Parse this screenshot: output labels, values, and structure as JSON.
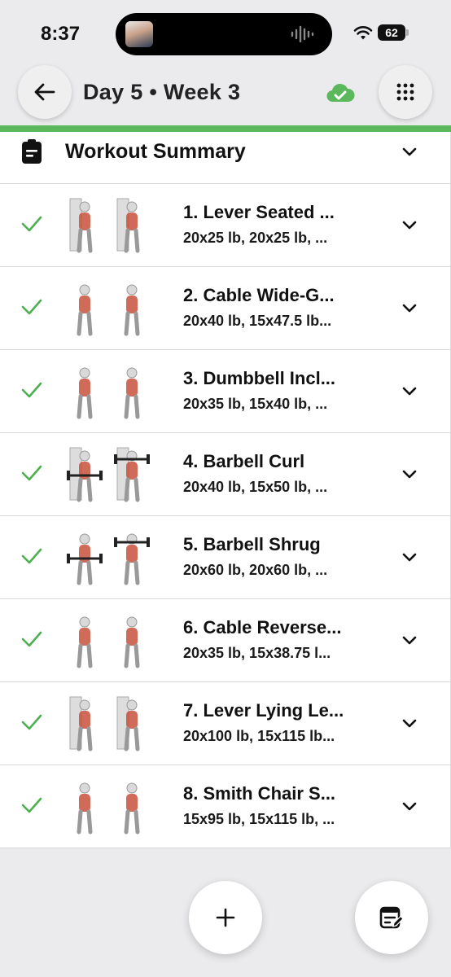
{
  "status": {
    "time": "8:37",
    "battery": "62"
  },
  "header": {
    "title": "Day 5 • Week 3"
  },
  "summary": {
    "title": "Workout Summary"
  },
  "colors": {
    "accent": "#5cb85c",
    "check": "#4caf50"
  },
  "exercises": [
    {
      "name": "1. Lever Seated ...",
      "sets": "20x25 lb, 20x25 lb, ..."
    },
    {
      "name": "2. Cable Wide-G...",
      "sets": "20x40 lb, 15x47.5 lb..."
    },
    {
      "name": "3. Dumbbell Incl...",
      "sets": "20x35 lb, 15x40 lb, ..."
    },
    {
      "name": "4. Barbell Curl",
      "sets": "20x40 lb, 15x50 lb, ..."
    },
    {
      "name": "5. Barbell Shrug",
      "sets": "20x60 lb, 20x60 lb, ..."
    },
    {
      "name": "6. Cable Reverse...",
      "sets": "20x35 lb, 15x38.75 l..."
    },
    {
      "name": "7. Lever Lying Le...",
      "sets": "20x100 lb, 15x115 lb..."
    },
    {
      "name": "8. Smith Chair S...",
      "sets": "15x95 lb, 15x115 lb, ..."
    }
  ]
}
